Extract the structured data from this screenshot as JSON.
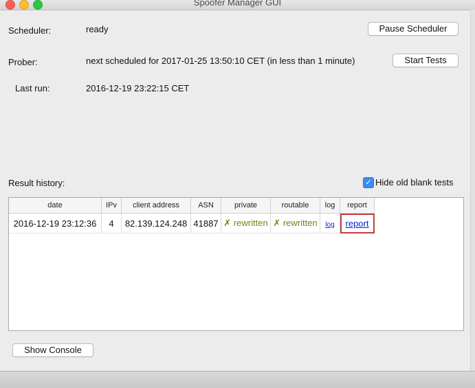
{
  "window": {
    "title": "Spoofer Manager GUI"
  },
  "scheduler": {
    "label": "Scheduler:",
    "status": "ready",
    "button": "Pause Scheduler"
  },
  "prober": {
    "label": "Prober:",
    "status": "next scheduled for 2017-01-25 13:50:10 CET  (in less than 1 minute)",
    "button": "Start Tests"
  },
  "last_run": {
    "label": "Last run:",
    "value": "2016-12-19 23:22:15 CET"
  },
  "history": {
    "label": "Result history:",
    "hide_old_label": "Hide old blank tests",
    "hide_old_checked": true,
    "columns": [
      "date",
      "IPv",
      "client address",
      "ASN",
      "private",
      "routable",
      "log",
      "report"
    ],
    "rows": [
      {
        "date": "2016-12-19 23:12:36",
        "ipv": "4",
        "client_address": "82.139.124.248",
        "asn": "41887",
        "private": "rewritten",
        "routable": "rewritten",
        "log": "log",
        "report": "report"
      }
    ]
  },
  "console_button": "Show Console"
}
